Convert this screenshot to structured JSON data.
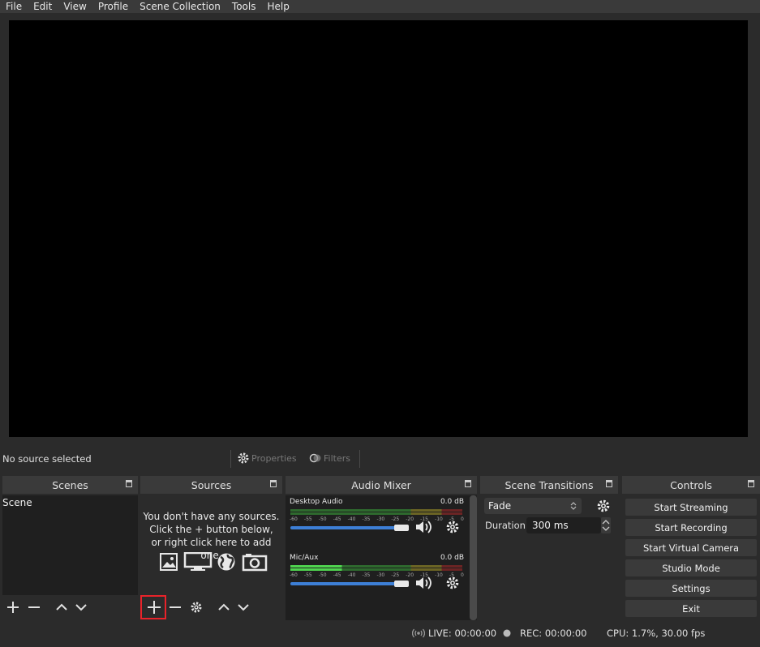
{
  "menu": [
    "File",
    "Edit",
    "View",
    "Profile",
    "Scene Collection",
    "Tools",
    "Help"
  ],
  "source_bar": {
    "no_source": "No source selected",
    "properties": "Properties",
    "filters": "Filters"
  },
  "scenes": {
    "title": "Scenes",
    "items": [
      "Scene"
    ]
  },
  "sources": {
    "title": "Sources",
    "empty_line1": "You don't have any sources.",
    "empty_line2": "Click the + button below,",
    "empty_line3": "or right click here to add one."
  },
  "mixer": {
    "title": "Audio Mixer",
    "channels": [
      {
        "name": "Desktop Audio",
        "db": "0.0 dB",
        "volume": 0.95,
        "level": 0.0
      },
      {
        "name": "Mic/Aux",
        "db": "0.0 dB",
        "volume": 0.95,
        "level": 0.3
      }
    ],
    "scale": [
      "-60",
      "-55",
      "-50",
      "-45",
      "-40",
      "-35",
      "-30",
      "-25",
      "-20",
      "-15",
      "-10",
      "-5",
      "0"
    ]
  },
  "transitions": {
    "title": "Scene Transitions",
    "selected": "Fade",
    "duration_label": "Duration",
    "duration_value": "300 ms"
  },
  "controls": {
    "title": "Controls",
    "buttons": [
      "Start Streaming",
      "Start Recording",
      "Start Virtual Camera",
      "Studio Mode",
      "Settings",
      "Exit"
    ]
  },
  "status": {
    "live": "LIVE: 00:00:00",
    "rec": "REC: 00:00:00",
    "cpu": "CPU: 1.7%, 30.00 fps"
  },
  "colors": {
    "highlight_box": "#e8232a",
    "slider": "#3d7fd6",
    "meter_green": "#4fd44f",
    "meter_yellow": "#d6c84a",
    "meter_red": "#d64a4a"
  }
}
